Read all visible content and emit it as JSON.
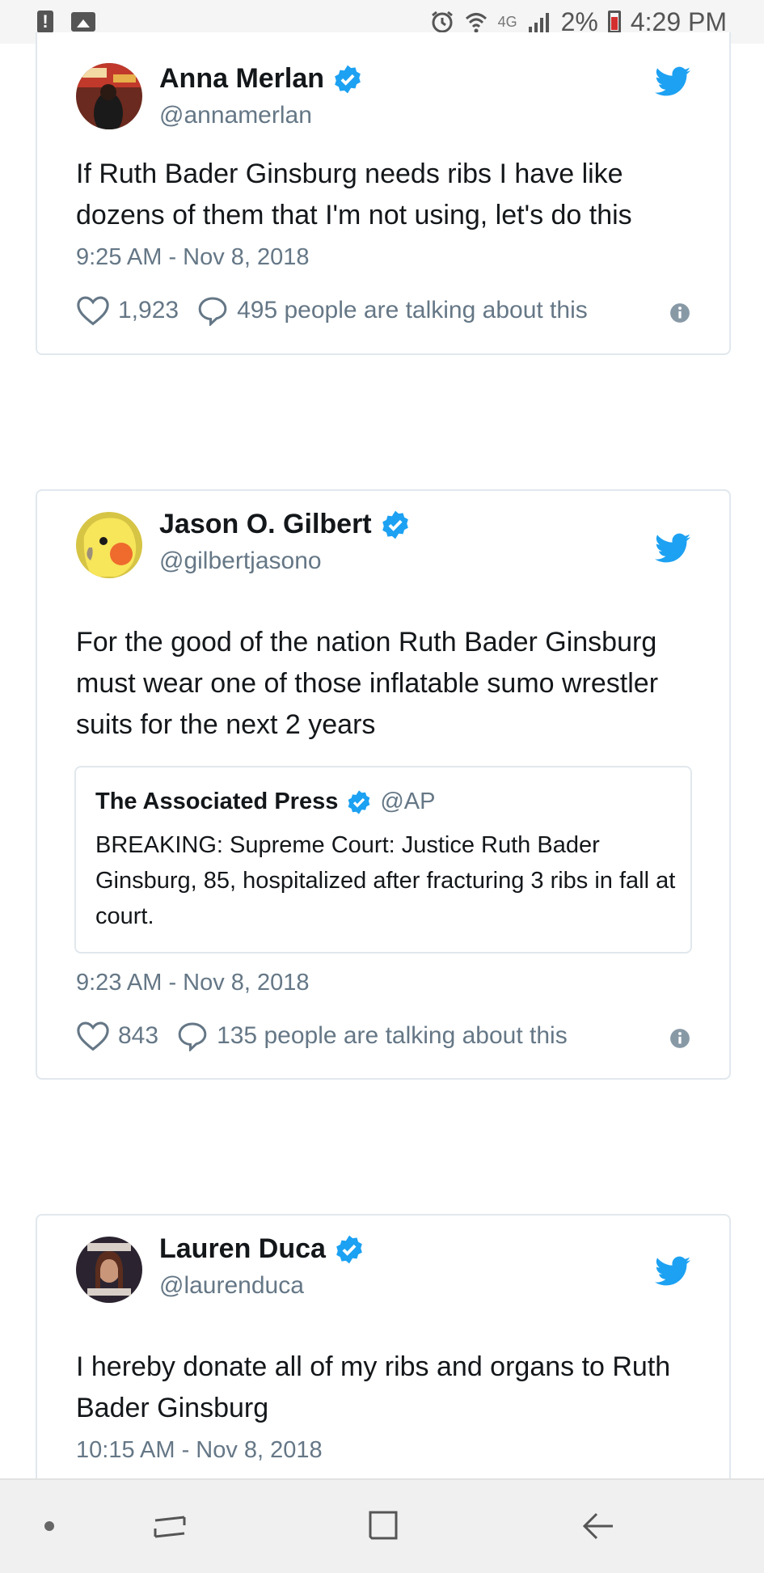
{
  "status_bar": {
    "network": "4G",
    "battery": "2%",
    "time": "4:29 PM"
  },
  "tweets": [
    {
      "name": "Anna Merlan",
      "handle": "@annamerlan",
      "text": "If Ruth Bader Ginsburg needs ribs I have like dozens of them that I'm not using, let's do this",
      "timestamp": "9:25 AM - Nov 8, 2018",
      "likes": "1,923",
      "talking": "495 people are talking about this"
    },
    {
      "name": "Jason O. Gilbert",
      "handle": "@gilbertjasono",
      "text": "For the good of the nation Ruth Bader Ginsburg must wear one of those inflatable sumo wrestler suits for the next 2 years",
      "quote": {
        "name": "The Associated Press",
        "handle": "@AP",
        "text": "BREAKING: Supreme Court: Justice Ruth Bader Ginsburg, 85, hospitalized after fracturing 3 ribs in fall at court."
      },
      "timestamp": "9:23 AM - Nov 8, 2018",
      "likes": "843",
      "talking": "135 people are talking about this"
    },
    {
      "name": "Lauren Duca",
      "handle": "@laurenduca",
      "text": "I hereby donate all of my ribs and organs to Ruth Bader Ginsburg",
      "timestamp": "10:15 AM - Nov 8, 2018"
    }
  ],
  "colors": {
    "twitter_blue": "#1da1f2",
    "secondary_text": "#657786",
    "border": "#e1e8ed"
  },
  "icons": [
    "heart-icon",
    "reply-icon",
    "info-icon",
    "twitter-bird-icon",
    "verified-badge-icon"
  ]
}
